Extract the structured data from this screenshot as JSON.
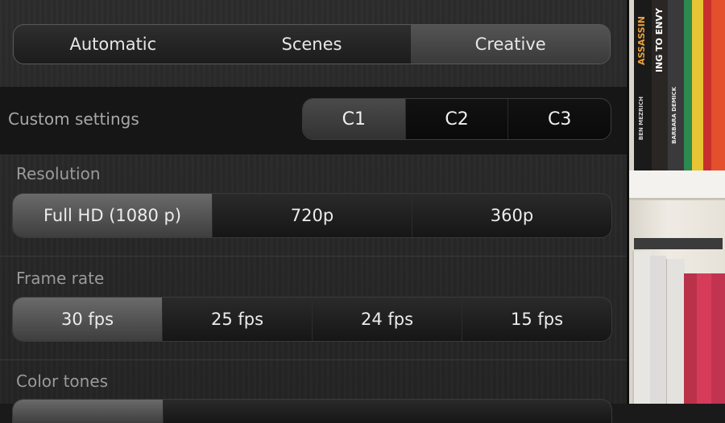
{
  "mode_tabs": [
    "Automatic",
    "Scenes",
    "Creative"
  ],
  "active_mode": "Creative",
  "custom_settings": {
    "label": "Custom settings",
    "options": [
      "C1",
      "C2",
      "C3"
    ],
    "selected": "C1"
  },
  "resolution": {
    "label": "Resolution",
    "options": [
      "Full HD (1080 p)",
      "720p",
      "360p"
    ],
    "selected": "Full HD (1080 p)"
  },
  "frame_rate": {
    "label": "Frame rate",
    "options": [
      "30 fps",
      "25 fps",
      "24 fps",
      "15 fps"
    ],
    "selected": "30 fps"
  },
  "color_tones": {
    "label": "Color tones"
  },
  "viewfinder": {
    "spines": [
      "ASSASSIN",
      "BEN MEZRICH",
      "ING TO ENVY",
      "BARBARA DEMICK"
    ]
  }
}
